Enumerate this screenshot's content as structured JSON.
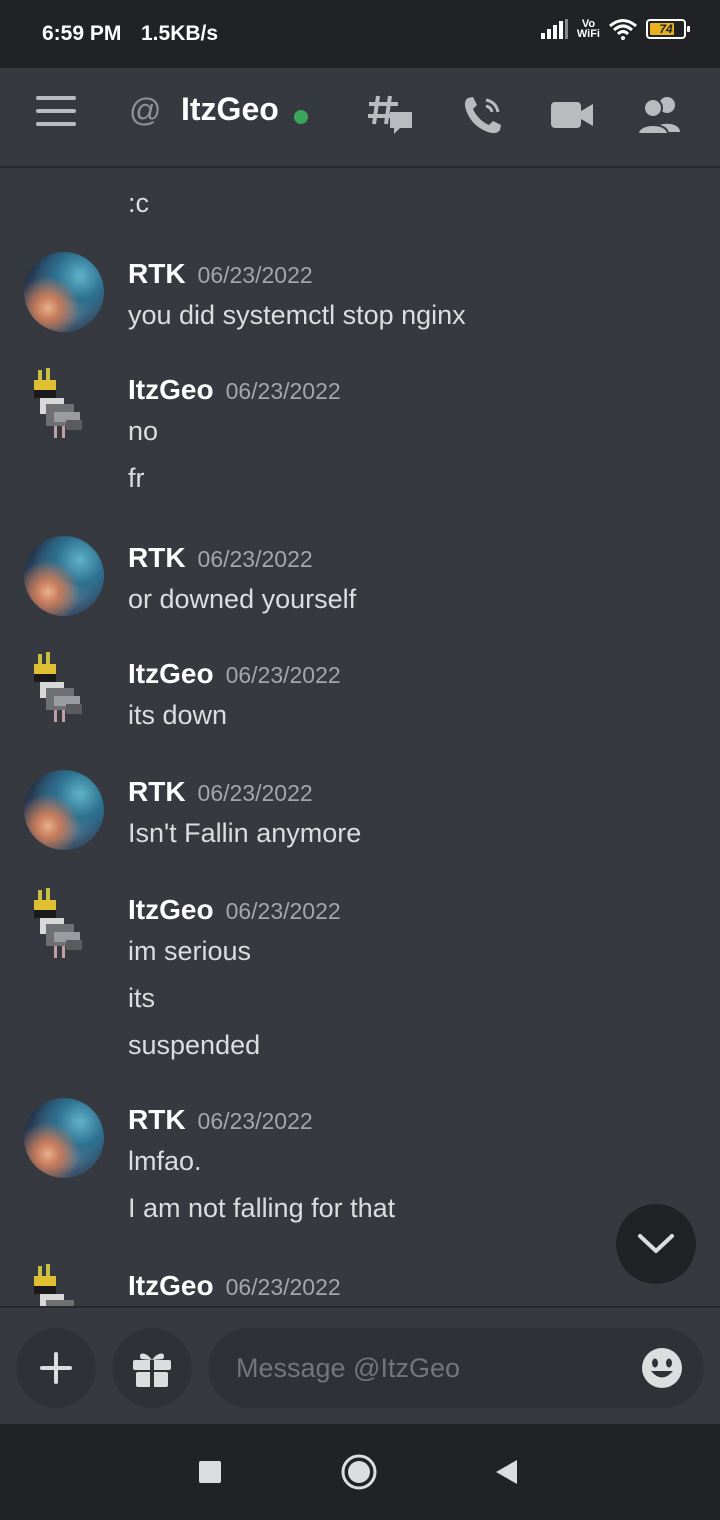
{
  "status_bar": {
    "time": "6:59 PM",
    "speed": "1.5KB/s",
    "vowifi_top": "Vo",
    "vowifi_bottom": "WiFi",
    "battery_level": "74",
    "battery_fraction": 0.74
  },
  "header": {
    "at_symbol": "@",
    "title": "ItzGeo",
    "status": "online",
    "icons": [
      "menu-icon",
      "threads-icon",
      "call-icon",
      "video-icon",
      "members-icon"
    ]
  },
  "messages": {
    "continuation": ":c",
    "groups": [
      {
        "author": "RTK",
        "timestamp": "06/23/2022",
        "avatar": "galaxy",
        "lines": [
          "you did systemctl stop nginx"
        ]
      },
      {
        "author": "ItzGeo",
        "timestamp": "06/23/2022",
        "avatar": "bird",
        "lines": [
          "no",
          "fr"
        ]
      },
      {
        "author": "RTK",
        "timestamp": "06/23/2022",
        "avatar": "galaxy",
        "lines": [
          "or downed yourself"
        ]
      },
      {
        "author": "ItzGeo",
        "timestamp": "06/23/2022",
        "avatar": "bird",
        "lines": [
          "its down"
        ]
      },
      {
        "author": "RTK",
        "timestamp": "06/23/2022",
        "avatar": "galaxy",
        "lines": [
          "Isn't Fallin anymore"
        ]
      },
      {
        "author": "ItzGeo",
        "timestamp": "06/23/2022",
        "avatar": "bird",
        "lines": [
          "im serious",
          "its",
          "suspended"
        ]
      },
      {
        "author": "RTK",
        "timestamp": "06/23/2022",
        "avatar": "galaxy",
        "lines": [
          "lmfao.",
          "I am not falling for that"
        ]
      },
      {
        "author": "ItzGeo",
        "timestamp": "06/23/2022",
        "avatar": "bird",
        "lines": []
      }
    ]
  },
  "composer": {
    "placeholder": "Message @ItzGeo",
    "icons": [
      "plus-icon",
      "gift-icon",
      "emoji-icon"
    ]
  },
  "navigation": {
    "icons": [
      "recents-icon",
      "home-icon",
      "back-icon"
    ]
  },
  "colors": {
    "background": "#36393f",
    "online": "#3ba55c",
    "battery": "#e9b21b"
  }
}
